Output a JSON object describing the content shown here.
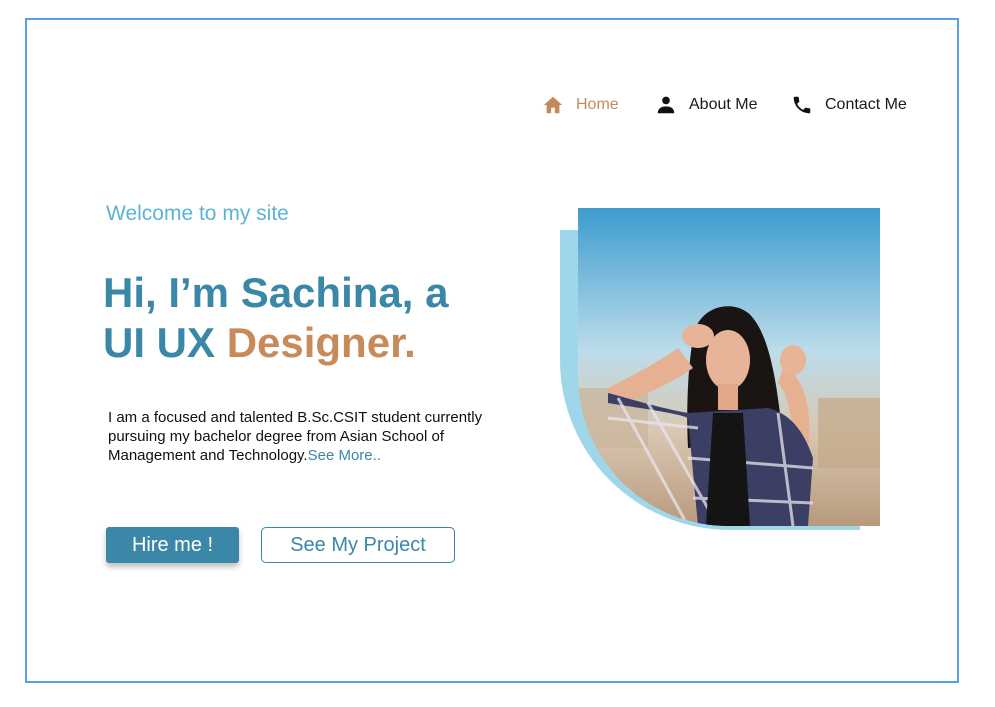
{
  "nav": {
    "items": [
      {
        "label": "Home",
        "icon": "home-icon",
        "active": true
      },
      {
        "label": "About Me",
        "icon": "person-icon",
        "active": false
      },
      {
        "label": "Contact Me",
        "icon": "phone-icon",
        "active": false
      }
    ]
  },
  "hero": {
    "welcome": "Welcome to my site",
    "headline_line1": "Hi, I’m Sachina, a",
    "headline_line2_prefix": "UI UX ",
    "headline_line2_accent": "Designer.",
    "intro": "I am a focused and talented B.Sc.CSIT student currently pursuing my bachelor degree from Asian School of Management and Technology.",
    "see_more": "See More.."
  },
  "buttons": {
    "hire": "Hire me !",
    "project": "See My Project"
  },
  "colors": {
    "primary": "#3a87a8",
    "accent": "#c98a5a",
    "welcome": "#5bb3d6",
    "frame": "#5aa0e0",
    "photo_backdrop": "#9fd6ea"
  }
}
